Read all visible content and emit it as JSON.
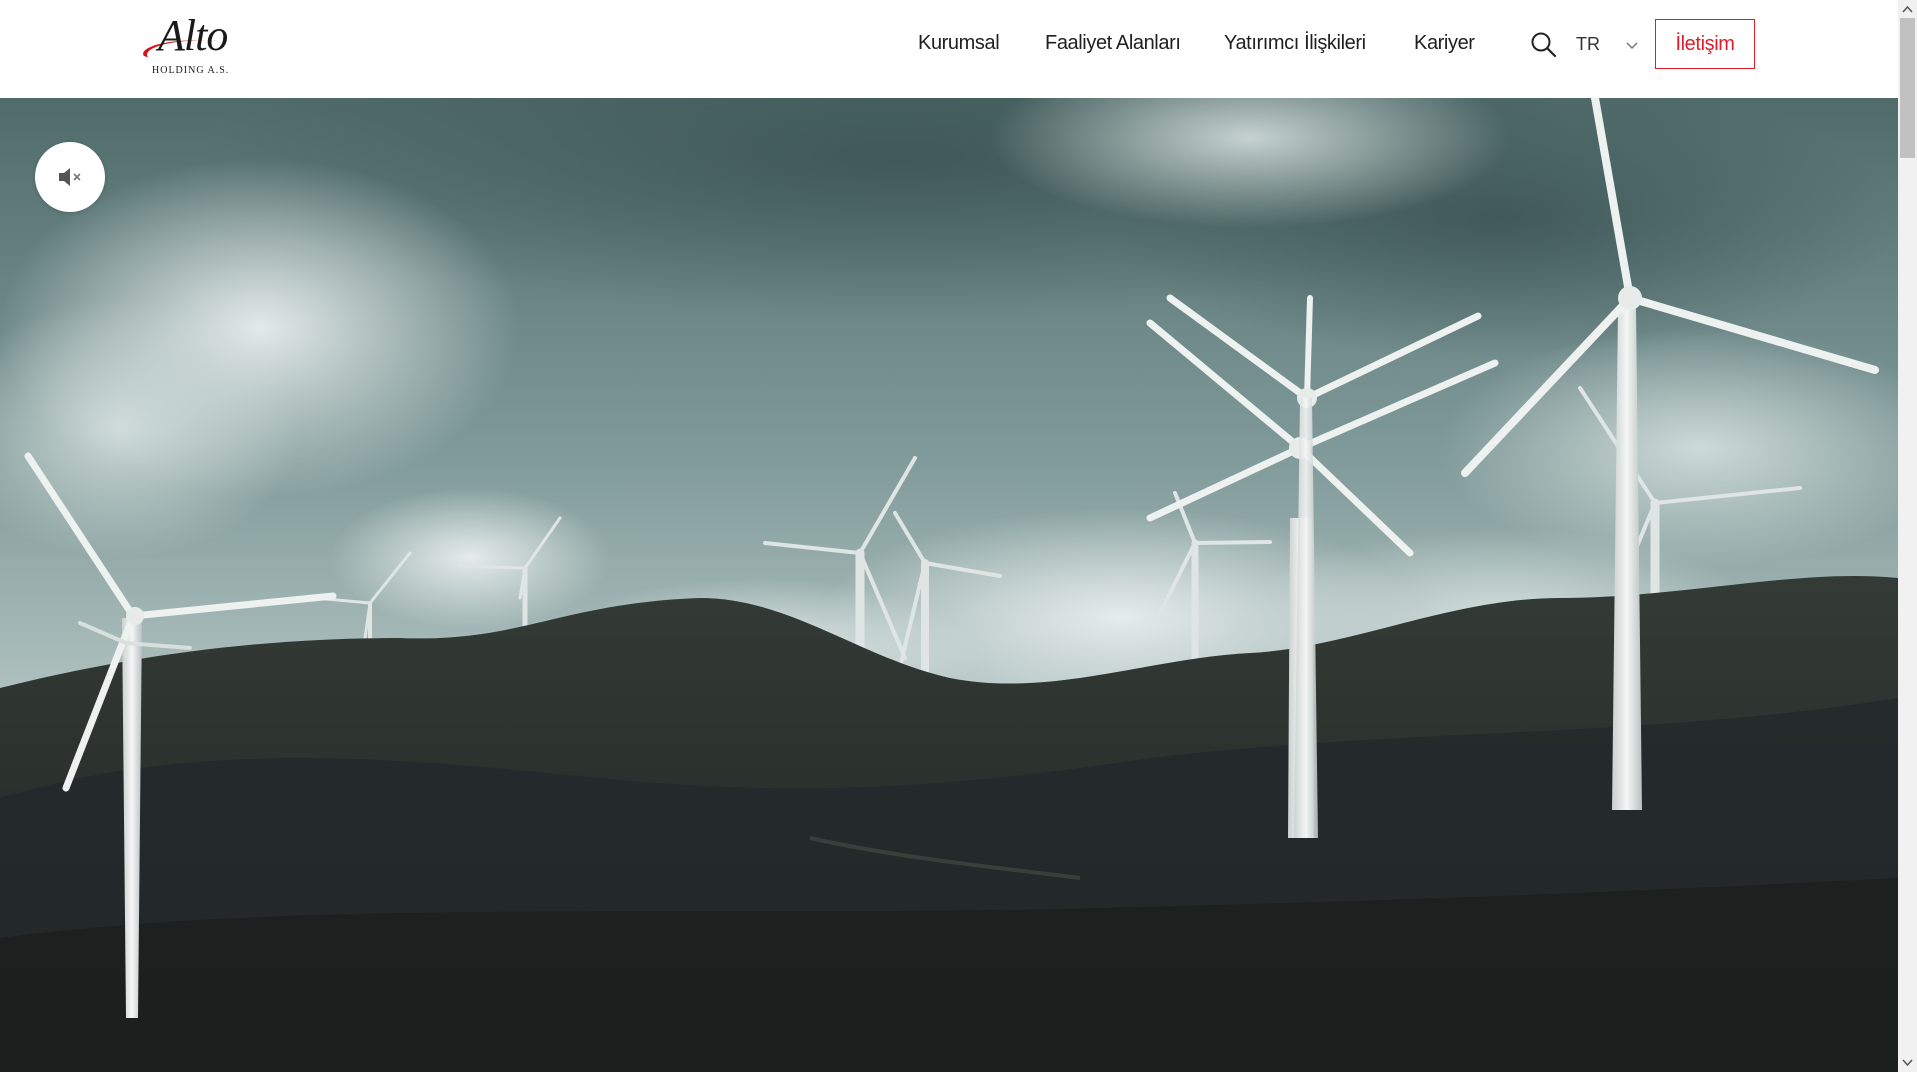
{
  "header": {
    "logo_text": "Alto",
    "logo_subtext": "HOLDING A.S.",
    "nav_items": [
      {
        "label": "Kurumsal"
      },
      {
        "label": "Faaliyet Alanları"
      },
      {
        "label": "Yatırımcı İlişkileri"
      },
      {
        "label": "Kariyer"
      }
    ],
    "search_icon": "search-icon",
    "language": "TR",
    "language_icon": "chevron-down-icon",
    "contact_label": "İletişim"
  },
  "hero": {
    "image_subject": "wind turbines on hills under a cloudy sky",
    "mute_icon": "speaker-muted-icon"
  },
  "colors": {
    "accent": "#e01e2b",
    "nav_text": "#1f1f1f",
    "header_bg": "#ffffff",
    "sky_dark": "#5b7574",
    "sky_light": "#c9d6d4",
    "hills": "#2a302c"
  }
}
